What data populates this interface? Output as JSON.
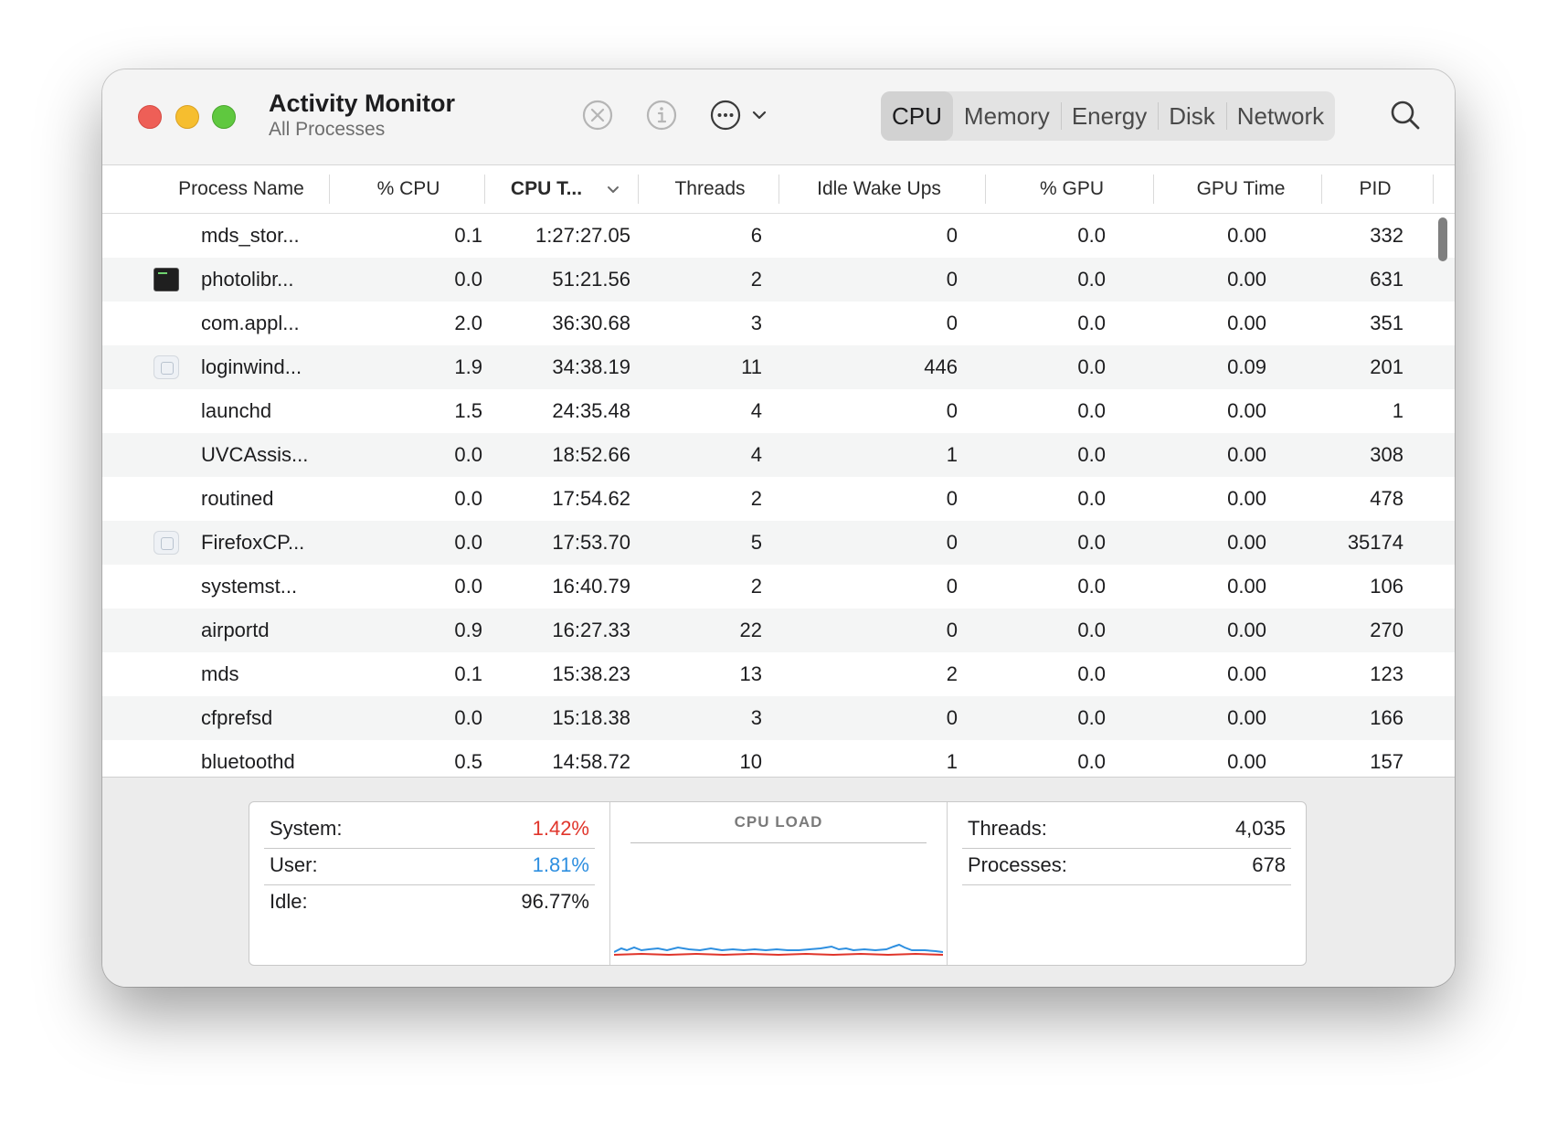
{
  "window": {
    "title": "Activity Monitor",
    "subtitle": "All Processes"
  },
  "toolbar": {
    "stop_icon": "x-circle-icon",
    "info_icon": "info-icon",
    "more_icon": "ellipsis-circle-icon",
    "search_icon": "magnifier-icon",
    "tabs": [
      {
        "label": "CPU",
        "selected": true
      },
      {
        "label": "Memory",
        "selected": false
      },
      {
        "label": "Energy",
        "selected": false
      },
      {
        "label": "Disk",
        "selected": false
      },
      {
        "label": "Network",
        "selected": false
      }
    ]
  },
  "table": {
    "columns": [
      "Process Name",
      "% CPU",
      "CPU T...",
      "Threads",
      "Idle Wake Ups",
      "% GPU",
      "GPU Time",
      "PID"
    ],
    "sorted_column": "CPU T...",
    "rows": [
      {
        "name": "mds_stor...",
        "icon": "none",
        "cpu": "0.1",
        "cpu_time": "1:27:27.05",
        "threads": "6",
        "idle_wake_ups": "0",
        "gpu": "0.0",
        "gpu_time": "0.00",
        "pid": "332"
      },
      {
        "name": "photolibr...",
        "icon": "terminal-icon",
        "cpu": "0.0",
        "cpu_time": "51:21.56",
        "threads": "2",
        "idle_wake_ups": "0",
        "gpu": "0.0",
        "gpu_time": "0.00",
        "pid": "631"
      },
      {
        "name": "com.appl...",
        "icon": "none",
        "cpu": "2.0",
        "cpu_time": "36:30.68",
        "threads": "3",
        "idle_wake_ups": "0",
        "gpu": "0.0",
        "gpu_time": "0.00",
        "pid": "351"
      },
      {
        "name": "loginwind...",
        "icon": "app-icon",
        "cpu": "1.9",
        "cpu_time": "34:38.19",
        "threads": "11",
        "idle_wake_ups": "446",
        "gpu": "0.0",
        "gpu_time": "0.09",
        "pid": "201"
      },
      {
        "name": "launchd",
        "icon": "none",
        "cpu": "1.5",
        "cpu_time": "24:35.48",
        "threads": "4",
        "idle_wake_ups": "0",
        "gpu": "0.0",
        "gpu_time": "0.00",
        "pid": "1"
      },
      {
        "name": "UVCAssis...",
        "icon": "none",
        "cpu": "0.0",
        "cpu_time": "18:52.66",
        "threads": "4",
        "idle_wake_ups": "1",
        "gpu": "0.0",
        "gpu_time": "0.00",
        "pid": "308"
      },
      {
        "name": "routined",
        "icon": "none",
        "cpu": "0.0",
        "cpu_time": "17:54.62",
        "threads": "2",
        "idle_wake_ups": "0",
        "gpu": "0.0",
        "gpu_time": "0.00",
        "pid": "478"
      },
      {
        "name": "FirefoxCP...",
        "icon": "app-icon",
        "cpu": "0.0",
        "cpu_time": "17:53.70",
        "threads": "5",
        "idle_wake_ups": "0",
        "gpu": "0.0",
        "gpu_time": "0.00",
        "pid": "35174"
      },
      {
        "name": "systemst...",
        "icon": "none",
        "cpu": "0.0",
        "cpu_time": "16:40.79",
        "threads": "2",
        "idle_wake_ups": "0",
        "gpu": "0.0",
        "gpu_time": "0.00",
        "pid": "106"
      },
      {
        "name": "airportd",
        "icon": "none",
        "cpu": "0.9",
        "cpu_time": "16:27.33",
        "threads": "22",
        "idle_wake_ups": "0",
        "gpu": "0.0",
        "gpu_time": "0.00",
        "pid": "270"
      },
      {
        "name": "mds",
        "icon": "none",
        "cpu": "0.1",
        "cpu_time": "15:38.23",
        "threads": "13",
        "idle_wake_ups": "2",
        "gpu": "0.0",
        "gpu_time": "0.00",
        "pid": "123"
      },
      {
        "name": "cfprefsd",
        "icon": "none",
        "cpu": "0.0",
        "cpu_time": "15:18.38",
        "threads": "3",
        "idle_wake_ups": "0",
        "gpu": "0.0",
        "gpu_time": "0.00",
        "pid": "166"
      },
      {
        "name": "bluetoothd",
        "icon": "none",
        "cpu": "0.5",
        "cpu_time": "14:58.72",
        "threads": "10",
        "idle_wake_ups": "1",
        "gpu": "0.0",
        "gpu_time": "0.00",
        "pid": "157"
      }
    ]
  },
  "stats": {
    "system_label": "System:",
    "system_value": "1.42%",
    "user_label": "User:",
    "user_value": "1.81%",
    "idle_label": "Idle:",
    "idle_value": "96.77%",
    "cpu_load_title": "CPU LOAD",
    "threads_label": "Threads:",
    "threads_value": "4,035",
    "processes_label": "Processes:",
    "processes_value": "678"
  },
  "colors": {
    "system": "#e0352b",
    "user": "#2e8fe0",
    "close": "#ee5f57",
    "minimize": "#f6be2f",
    "zoom": "#5fc83f"
  }
}
